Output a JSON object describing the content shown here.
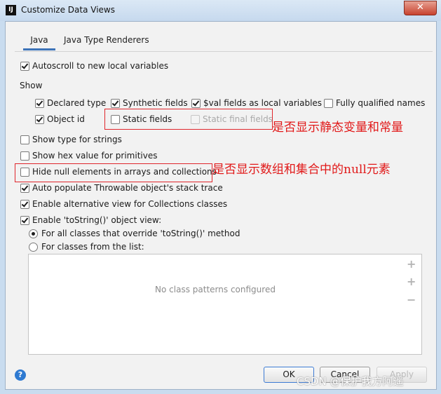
{
  "window": {
    "title": "Customize Data Views",
    "icon_text": "IJ",
    "close_label": "✕"
  },
  "tabs": [
    {
      "label": "Java",
      "selected": true
    },
    {
      "label": "Java Type Renderers",
      "selected": false
    }
  ],
  "options": {
    "autoscroll": {
      "label": "Autoscroll to new local variables",
      "checked": true
    },
    "show_heading": "Show",
    "declared_type": {
      "label": "Declared type",
      "checked": true
    },
    "synthetic_fields": {
      "label": "Synthetic fields",
      "checked": true
    },
    "val_fields": {
      "label": "$val fields as local variables",
      "checked": true
    },
    "fully_qualified": {
      "label": "Fully qualified names",
      "checked": false
    },
    "object_id": {
      "label": "Object id",
      "checked": true
    },
    "static_fields": {
      "label": "Static fields",
      "checked": false
    },
    "static_final_fields": {
      "label": "Static final fields",
      "checked": false,
      "disabled": true
    },
    "type_for_strings": {
      "label": "Show type for strings",
      "checked": false
    },
    "hex_values": {
      "label": "Show hex value for primitives",
      "checked": false
    },
    "hide_null": {
      "label": "Hide null elements in arrays and collections",
      "checked": false
    },
    "auto_populate": {
      "label": "Auto populate Throwable object's stack trace",
      "checked": true
    },
    "alt_view": {
      "label": "Enable alternative view for Collections classes",
      "checked": true
    },
    "tostring": {
      "label": "Enable 'toString()' object view:",
      "checked": true
    },
    "radio_all": {
      "label": "For all classes that override 'toString()' method",
      "selected": true
    },
    "radio_list": {
      "label": "For classes from the list:",
      "selected": false
    }
  },
  "class_list": {
    "empty_text": "No class patterns configured"
  },
  "annotations": {
    "static_note": "是否显示静态变量和常量",
    "null_note": "是否显示数组和集合中的null元素"
  },
  "footer": {
    "help": "?",
    "ok": "OK",
    "cancel": "Cancel",
    "apply": "Apply"
  },
  "watermark": "CSDN @保护我方阿遥",
  "colors": {
    "accent": "#3d73b8",
    "annotation_red": "#e11919",
    "help_blue": "#2e7ad1"
  }
}
